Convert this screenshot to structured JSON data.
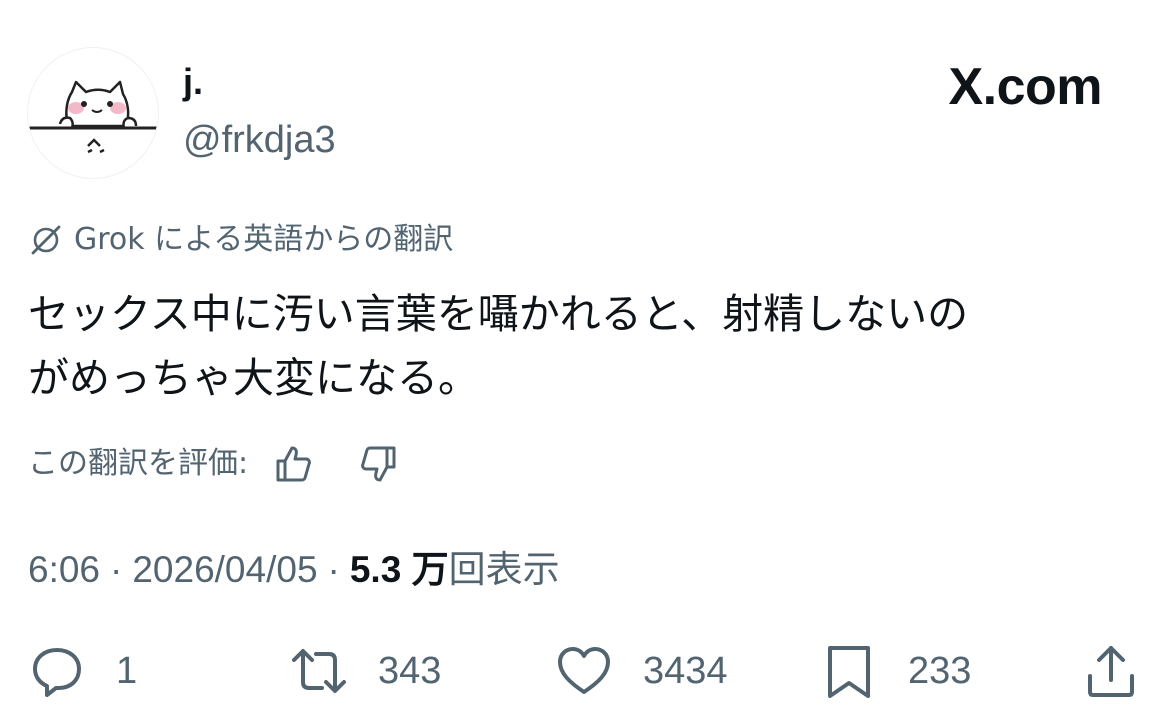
{
  "author": {
    "display_name": "j.",
    "handle": "@frkdja3"
  },
  "site": {
    "logo_label": "X.com"
  },
  "translation": {
    "label": "Grok による英語からの翻訳",
    "icon": "grok-icon"
  },
  "tweet": {
    "text": "セックス中に汚い言葉を囁かれると、射精しないの\nがめっちゃ大変になる。"
  },
  "rating": {
    "label": "この翻訳を評価:",
    "like_icon": "thumbs-up-icon",
    "dislike_icon": "thumbs-down-icon"
  },
  "meta": {
    "time": "6:06",
    "separator": "·",
    "date": "2026/04/05",
    "views_count": "5.3 万",
    "views_label": "回表示"
  },
  "actions": {
    "reply": {
      "icon": "reply-icon",
      "count": "1"
    },
    "repost": {
      "icon": "repost-icon",
      "count": "343"
    },
    "like": {
      "icon": "heart-icon",
      "count": "3434"
    },
    "bookmark": {
      "icon": "bookmark-icon",
      "count": "233"
    },
    "share": {
      "icon": "share-icon"
    }
  }
}
